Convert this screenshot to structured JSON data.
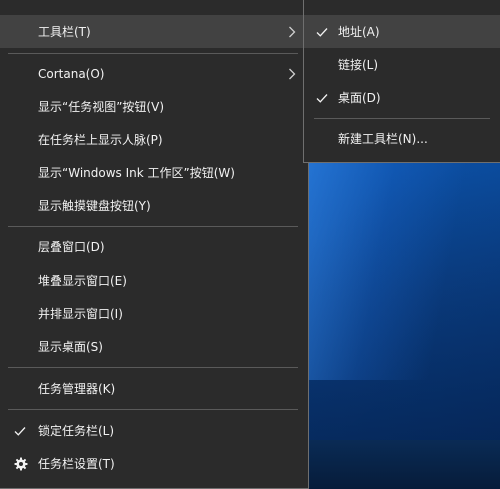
{
  "main_menu": {
    "items": [
      {
        "label": "工具栏(T)"
      },
      {
        "label": "Cortana(O)"
      },
      {
        "label": "显示“任务视图”按钮(V)"
      },
      {
        "label": "在任务栏上显示人脉(P)"
      },
      {
        "label": "显示“Windows Ink 工作区”按钮(W)"
      },
      {
        "label": "显示触摸键盘按钮(Y)"
      },
      {
        "label": "层叠窗口(D)"
      },
      {
        "label": "堆叠显示窗口(E)"
      },
      {
        "label": "并排显示窗口(I)"
      },
      {
        "label": "显示桌面(S)"
      },
      {
        "label": "任务管理器(K)"
      },
      {
        "label": "锁定任务栏(L)",
        "checked": true
      },
      {
        "label": "任务栏设置(T)",
        "icon": "gear-icon"
      }
    ]
  },
  "toolbars_submenu": {
    "items": [
      {
        "label": "地址(A)",
        "checked": true
      },
      {
        "label": "链接(L)",
        "checked": false
      },
      {
        "label": "桌面(D)",
        "checked": true
      },
      {
        "label": "新建工具栏(N)..."
      }
    ]
  },
  "colors": {
    "menu_bg": "#2b2b2b",
    "hover_bg": "#424242",
    "text": "#f2f2f2",
    "separator": "#5a5a5a",
    "desktop_accent": "#0a56b4"
  }
}
